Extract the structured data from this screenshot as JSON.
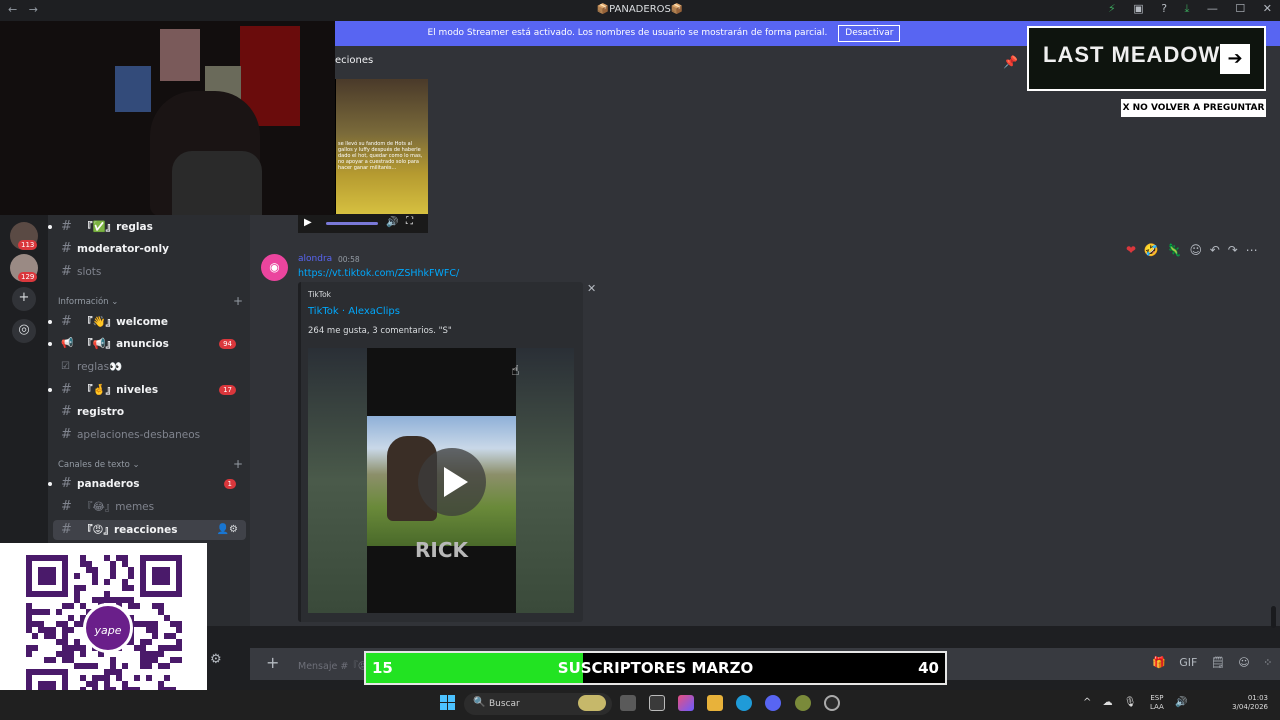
{
  "window": {
    "title": "📦PANADEROS📦",
    "back": "←",
    "forward": "→",
    "controls": [
      "⚡",
      "▣",
      "?",
      "⤓",
      "—",
      "☐",
      "✕"
    ]
  },
  "banner": {
    "message": "El modo Streamer está activado. Los nombres de usuario se mostrarán de forma parcial.",
    "button": "Desactivar"
  },
  "servers": [
    {
      "badge": "113"
    },
    {
      "badge": "129"
    }
  ],
  "rail_buttons": [
    "+",
    "◎"
  ],
  "sidebar": {
    "categories": [
      {
        "label": "Información ⌄",
        "plus": "+"
      },
      {
        "label": "Canales de texto ⌄",
        "plus": "+"
      }
    ],
    "channels": [
      {
        "icon": "#",
        "name": "『✅』reglas",
        "badge": ""
      },
      {
        "icon": "#",
        "name": "moderator-only",
        "badge": ""
      },
      {
        "icon": "#",
        "name": "slots",
        "badge": ""
      },
      {
        "icon": "#",
        "name": "『👋』welcome",
        "badge": ""
      },
      {
        "icon": "📢",
        "name": "『📢』anuncios",
        "badge": "94"
      },
      {
        "icon": "☑",
        "name": "reglas👀",
        "badge": ""
      },
      {
        "icon": "#",
        "name": "『🤞』niveles",
        "badge": "17"
      },
      {
        "icon": "#",
        "name": "registro",
        "badge": ""
      },
      {
        "icon": "#",
        "name": "apelaciones-desbaneos",
        "badge": ""
      },
      {
        "icon": "#",
        "name": "panaderos",
        "badge": "1"
      },
      {
        "icon": "#",
        "name": "『😂』memes",
        "badge": ""
      },
      {
        "icon": "#",
        "name": "『😡』reacciones",
        "badge": ""
      }
    ],
    "active_actions": "👤⚙",
    "settings_icon": "⚙"
  },
  "main": {
    "channel_name": "eciones",
    "header_icon": "📌",
    "message": {
      "avatar_glyph": "◉",
      "username": "alondra",
      "time": "00:58",
      "link": "https://vt.tiktok.com/ZSHhkFWFC/",
      "reactions": [
        "❤",
        "🤣",
        "🦎",
        "☺",
        "↶",
        "↷",
        "⋯"
      ]
    },
    "embed": {
      "provider": "TikTok",
      "title": "TikTok · AlexaClips",
      "description": "264 me gusta, 3 comentarios. \"S\"",
      "video_text": "RICK",
      "close": "✕"
    },
    "first_video_caption": "se llevó su fandom de Hots al gallos y luffy después de haberle dado el hot, quedar como lo mas, no apoyar a cuestrado solo para hacer ganar militarés..."
  },
  "composer": {
    "plus": "+",
    "placeholder": "Mensaje #『😡』reacciones",
    "icons": [
      "🎁",
      "GIF",
      "🗒",
      "☺",
      "⁘"
    ]
  },
  "subs_goal": {
    "current": "15",
    "label": "SUSCRIPTORES MARZO",
    "goal": "40",
    "progress": 0.375,
    "color": "#22e322"
  },
  "ad": {
    "title": "LAST MEADOW",
    "arrow": "➔",
    "dismiss": "X NO VOLVER A PREGUNTAR"
  },
  "qr": {
    "logo_text": "yape"
  },
  "taskbar": {
    "search_icon": "🔍",
    "search": "Buscar",
    "tray": [
      "^",
      "☁",
      "🎙",
      "🔊"
    ],
    "lang_line1": "ESP",
    "lang_line2": "LAA",
    "time": "01:03",
    "date": "3/04/2026"
  }
}
